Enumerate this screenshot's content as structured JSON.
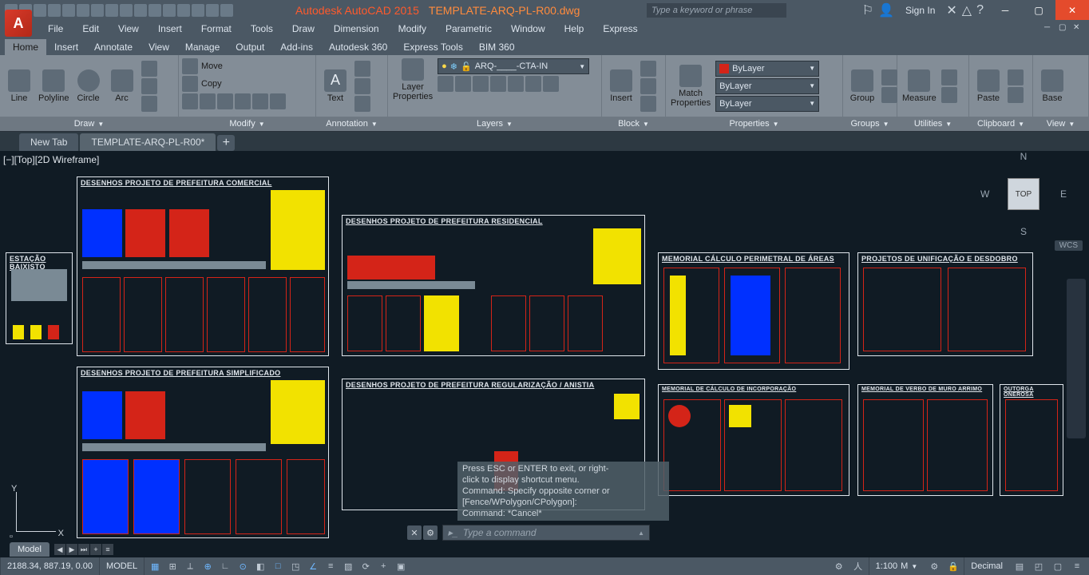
{
  "app": {
    "title_vendor": "Autodesk AutoCAD 2015",
    "title_file": "TEMPLATE-ARQ-PL-R00.dwg",
    "search_placeholder": "Type a keyword or phrase",
    "signin": "Sign In"
  },
  "menubar": [
    "File",
    "Edit",
    "View",
    "Insert",
    "Format",
    "Tools",
    "Draw",
    "Dimension",
    "Modify",
    "Parametric",
    "Window",
    "Help",
    "Express"
  ],
  "ribbonTabs": [
    "Home",
    "Insert",
    "Annotate",
    "View",
    "Manage",
    "Output",
    "Add-ins",
    "Autodesk 360",
    "Express Tools",
    "BIM 360"
  ],
  "ribbon_active": "Home",
  "panels": {
    "draw": {
      "label": "Draw",
      "tools": [
        "Line",
        "Polyline",
        "Circle",
        "Arc"
      ]
    },
    "modify": {
      "label": "Modify",
      "move": "Move",
      "copy": "Copy"
    },
    "annotation": {
      "label": "Annotation",
      "text": "Text"
    },
    "layers": {
      "label": "Layers",
      "prop": "Layer\nProperties",
      "combo": "ARQ-____-CTA-IN"
    },
    "block": {
      "label": "Block",
      "insert": "Insert"
    },
    "properties": {
      "label": "Properties",
      "match": "Match\nProperties",
      "bylayer1": "ByLayer",
      "bylayer2": "ByLayer",
      "bylayer3": "ByLayer"
    },
    "groups": {
      "label": "Groups",
      "group": "Group"
    },
    "utilities": {
      "label": "Utilities",
      "measure": "Measure"
    },
    "clipboard": {
      "label": "Clipboard",
      "paste": "Paste"
    },
    "view": {
      "label": "View",
      "base": "Base"
    }
  },
  "fileTabs": {
    "new": "New Tab",
    "active": "TEMPLATE-ARQ-PL-R00*",
    "add": "+"
  },
  "viewport_label": "[−][Top][2D Wireframe]",
  "viewcube": {
    "top": "TOP",
    "n": "N",
    "s": "S",
    "e": "E",
    "w": "W",
    "wcs": "WCS"
  },
  "ucs": {
    "x": "X",
    "y": "Y"
  },
  "drawings": {
    "estacao": "ESTAÇÃO BAIXISTO",
    "comercial": "DESENHOS PROJETO DE PREFEITURA COMERCIAL",
    "residencial": "DESENHOS PROJETO DE PREFEITURA RESIDENCIAL",
    "simplificado": "DESENHOS PROJETO DE PREFEITURA SIMPLIFICADO",
    "regularizacao": "DESENHOS PROJETO DE PREFEITURA REGULARIZAÇÃO / ANISTIA",
    "memorial": "MEMORIAL CÁLCULO PERIMETRAL DE ÁREAS",
    "unificacao": "PROJETOS DE UNIFICAÇÃO E DESDOBRO",
    "mem2": "MEMORIAL DE CÁLCULO DE INCORPORAÇÃO",
    "mem3": "MEMORIAL DE VERBO DE MURO ARRIMO",
    "outorga": "OUTORGA ONEROSA"
  },
  "cmd_history": {
    "l1": "Press ESC or ENTER to exit, or right-",
    "l2": "click to display shortcut menu.",
    "l3": "Command: Specify opposite corner or",
    "l4": "[Fence/WPolygon/CPolygon]:",
    "l5": "Command: *Cancel*"
  },
  "cmd_placeholder": "Type a command",
  "modelTab": "Model",
  "status": {
    "coords": "2188.34, 887.19, 0.00",
    "model": "MODEL",
    "scale": "1:100",
    "units": "M",
    "decimal": "Decimal"
  }
}
